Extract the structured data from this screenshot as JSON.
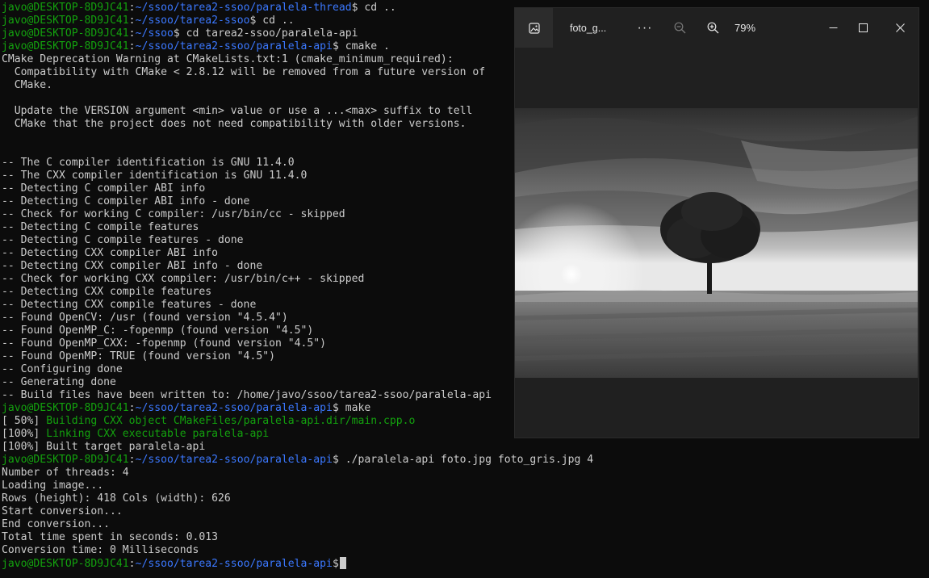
{
  "terminal": {
    "user": "javo@DESKTOP-8D9JC41",
    "paths": {
      "thread": "~/ssoo/tarea2-ssoo/paralela-thread",
      "tarea2": "~/ssoo/tarea2-ssoo",
      "ssoo": "~/ssoo",
      "api": "~/ssoo/tarea2-ssoo/paralela-api"
    },
    "commands": {
      "c1": " cd ..",
      "c2": " cd ..",
      "c3": " cd tarea2-ssoo/paralela-api",
      "c4": " cmake .",
      "c5": " make",
      "c6": " ./paralela-api foto.jpg foto_gris.jpg 4",
      "c7": ""
    },
    "output": [
      "CMake Deprecation Warning at CMakeLists.txt:1 (cmake_minimum_required):",
      "  Compatibility with CMake < 2.8.12 will be removed from a future version of",
      "  CMake.",
      "",
      "  Update the VERSION argument <min> value or use a ...<max> suffix to tell",
      "  CMake that the project does not need compatibility with older versions.",
      "",
      "",
      "-- The C compiler identification is GNU 11.4.0",
      "-- The CXX compiler identification is GNU 11.4.0",
      "-- Detecting C compiler ABI info",
      "-- Detecting C compiler ABI info - done",
      "-- Check for working C compiler: /usr/bin/cc - skipped",
      "-- Detecting C compile features",
      "-- Detecting C compile features - done",
      "-- Detecting CXX compiler ABI info",
      "-- Detecting CXX compiler ABI info - done",
      "-- Check for working CXX compiler: /usr/bin/c++ - skipped",
      "-- Detecting CXX compile features",
      "-- Detecting CXX compile features - done",
      "-- Found OpenCV: /usr (found version \"4.5.4\")",
      "-- Found OpenMP_C: -fopenmp (found version \"4.5\")",
      "-- Found OpenMP_CXX: -fopenmp (found version \"4.5\")",
      "-- Found OpenMP: TRUE (found version \"4.5\")",
      "-- Configuring done",
      "-- Generating done",
      "-- Build files have been written to: /home/javo/ssoo/tarea2-ssoo/paralela-api"
    ],
    "make_output": {
      "m1_prefix": "[ 50%] ",
      "m1_text": "Building CXX object CMakeFiles/paralela-api.dir/main.cpp.o",
      "m2_prefix": "[100%] ",
      "m2_text": "Linking CXX executable paralela-api",
      "m3": "[100%] Built target paralela-api"
    },
    "run_output": [
      "Number of threads: 4",
      "Loading image...",
      "Rows (height): 418 Cols (width): 626",
      "Start conversion...",
      "End conversion...",
      "Total time spent in seconds: 0.013",
      "Conversion time: 0 Milliseconds"
    ]
  },
  "viewer": {
    "file_name": "foto_g...",
    "more_label": "···",
    "zoom_level": "79%",
    "icons": {
      "app": "image-icon",
      "zoom_out": "zoom-out-icon",
      "zoom_in": "zoom-in-icon",
      "minimize": "minimize-icon",
      "maximize": "maximize-icon",
      "close": "close-icon"
    }
  },
  "colors": {
    "terminal_bg": "#0c0c0c",
    "terminal_text": "#cccccc",
    "prompt_user": "#13a10e",
    "prompt_path": "#3b78ff",
    "viewer_bg": "#202020"
  }
}
